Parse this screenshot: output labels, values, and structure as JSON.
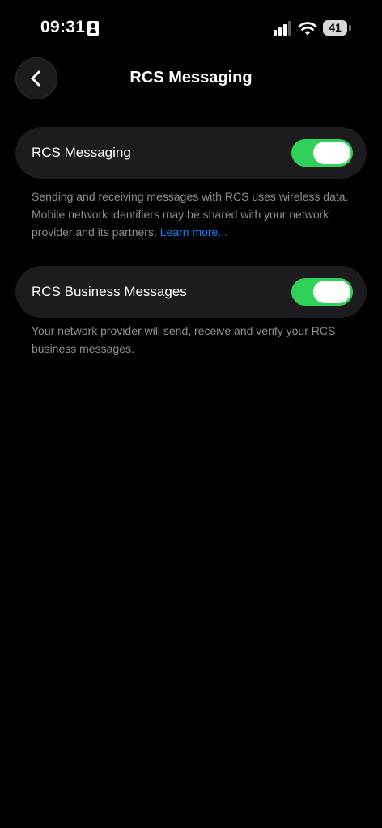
{
  "status_bar": {
    "time": "09:31",
    "battery": "41"
  },
  "nav": {
    "title": "RCS Messaging",
    "back_icon": "chevron-left-icon"
  },
  "settings": [
    {
      "label": "RCS Messaging",
      "enabled": true,
      "footnote": "Sending and receiving messages with RCS uses wireless data. Mobile network identifiers may be shared with your network provider and its partners.",
      "link": "Learn more..."
    },
    {
      "label": "RCS Business Messages",
      "enabled": true,
      "footnote": "Your network provider will send, receive and verify your RCS business messages."
    }
  ],
  "colors": {
    "background": "#000000",
    "row_background": "#1c1c1e",
    "toggle_on": "#30d158",
    "footnote": "#8e8e93",
    "link": "#0a84ff"
  }
}
